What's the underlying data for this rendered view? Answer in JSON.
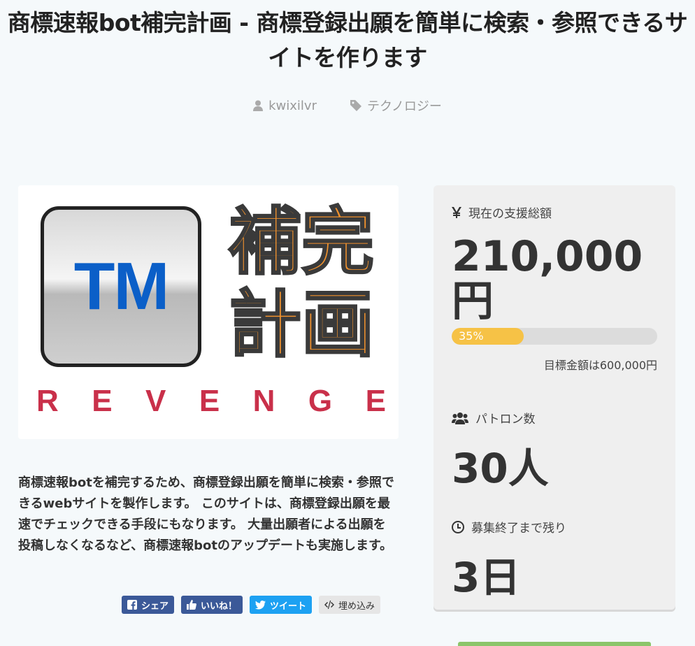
{
  "page": {
    "title": "商標速報bot補完計画 - 商標登録出願を簡単に検索・参照できるサイトを作ります",
    "author": "kwixilvr",
    "category": "テクノロジー"
  },
  "hero": {
    "tm_text": "TM",
    "kanji_line1": "補完",
    "kanji_line2": "計画",
    "revenge_letters": [
      "R",
      "E",
      "V",
      "E",
      "N",
      "G",
      "E"
    ]
  },
  "description": "商標速報botを補完するため、商標登録出願を簡単に検索・参照できるwebサイトを製作します。 このサイトは、商標登録出願を最速でチェックできる手段にもなります。 大量出願者による出願を投稿しなくなるなど、商標速報botのアップデートも実施します。",
  "share": {
    "facebook": "シェア",
    "like": "いいね！",
    "tweet": "ツイート",
    "embed": "埋め込み"
  },
  "stats": {
    "total_label": "現在の支援総額",
    "total_amount": "210,000円",
    "progress_label": "35%",
    "progress_fraction": 0.35,
    "goal_text": "目標金額は600,000円",
    "patrons_label": "パトロン数",
    "patrons_value": "30人",
    "remaining_label": "募集終了まで残り",
    "remaining_value": "3日"
  },
  "colors": {
    "accent_progress": "#f6c246",
    "facebook": "#3b5998",
    "twitter": "#1da1f2",
    "revenge": "#c9304a",
    "kanji": "#f0922e",
    "tm_blue": "#0b5fc8"
  }
}
